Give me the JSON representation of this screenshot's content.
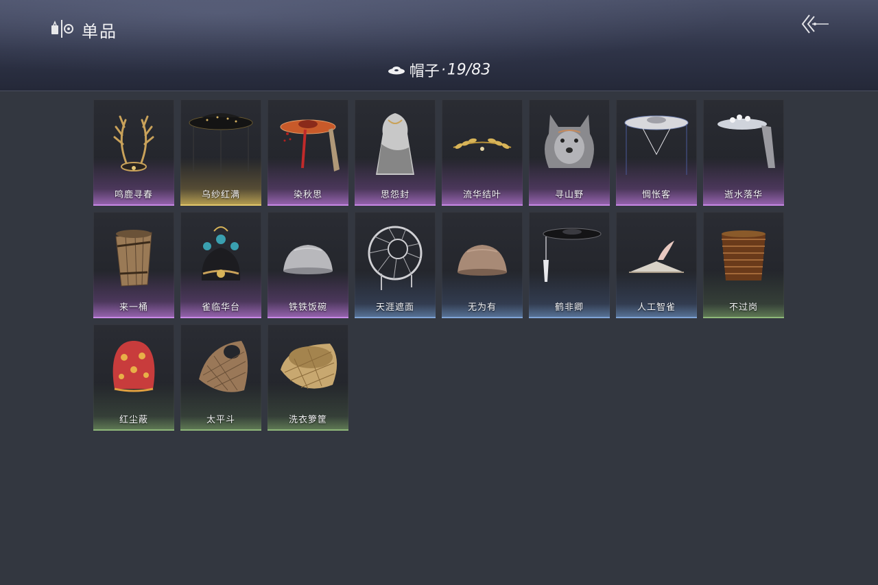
{
  "header": {
    "title": "单品",
    "logo_icon": "hanger-tag-icon",
    "back_icon": "back-arrow-icon"
  },
  "category": {
    "icon": "hat-icon",
    "name": "帽子",
    "separator": "·",
    "count": "19/83"
  },
  "colors": {
    "purple": "#c889e6",
    "gold": "#e3c86a",
    "blue": "#7fa4d6",
    "green": "#8fb87a",
    "background": "#333740"
  },
  "items": [
    {
      "name": "鸣鹿寻春",
      "rarity": "purple",
      "icon": "antler-crown-icon"
    },
    {
      "name": "乌纱红满",
      "rarity": "gold",
      "icon": "veiled-black-hat-icon"
    },
    {
      "name": "染秋思",
      "rarity": "purple",
      "icon": "red-straw-hat-icon"
    },
    {
      "name": "思怨封",
      "rarity": "purple",
      "icon": "ink-hood-icon"
    },
    {
      "name": "流华结叶",
      "rarity": "purple",
      "icon": "golden-leaf-wreath-icon"
    },
    {
      "name": "寻山野",
      "rarity": "purple",
      "icon": "wolf-hood-icon"
    },
    {
      "name": "惆怅客",
      "rarity": "purple",
      "icon": "silver-veiled-hat-icon"
    },
    {
      "name": "逝水落华",
      "rarity": "purple",
      "icon": "white-floral-hat-icon"
    },
    {
      "name": "来一桶",
      "rarity": "purple",
      "icon": "wooden-bucket-icon"
    },
    {
      "name": "雀临华台",
      "rarity": "purple",
      "icon": "phoenix-crown-icon"
    },
    {
      "name": "铁铁饭碗",
      "rarity": "purple",
      "icon": "iron-bowl-icon"
    },
    {
      "name": "天涯遮面",
      "rarity": "blue",
      "icon": "bamboo-frame-hat-icon"
    },
    {
      "name": "无为有",
      "rarity": "blue",
      "icon": "clay-bowl-icon"
    },
    {
      "name": "鹤非卿",
      "rarity": "blue",
      "icon": "black-brim-hat-icon"
    },
    {
      "name": "人工智雀",
      "rarity": "blue",
      "icon": "bird-hat-icon"
    },
    {
      "name": "不过岗",
      "rarity": "green",
      "icon": "stacked-bowls-icon"
    },
    {
      "name": "红尘蔽",
      "rarity": "green",
      "icon": "red-cloth-hood-icon"
    },
    {
      "name": "太平斗",
      "rarity": "green",
      "icon": "woven-basket-hat-icon"
    },
    {
      "name": "洗衣箩筐",
      "rarity": "green",
      "icon": "laundry-basket-icon"
    }
  ]
}
